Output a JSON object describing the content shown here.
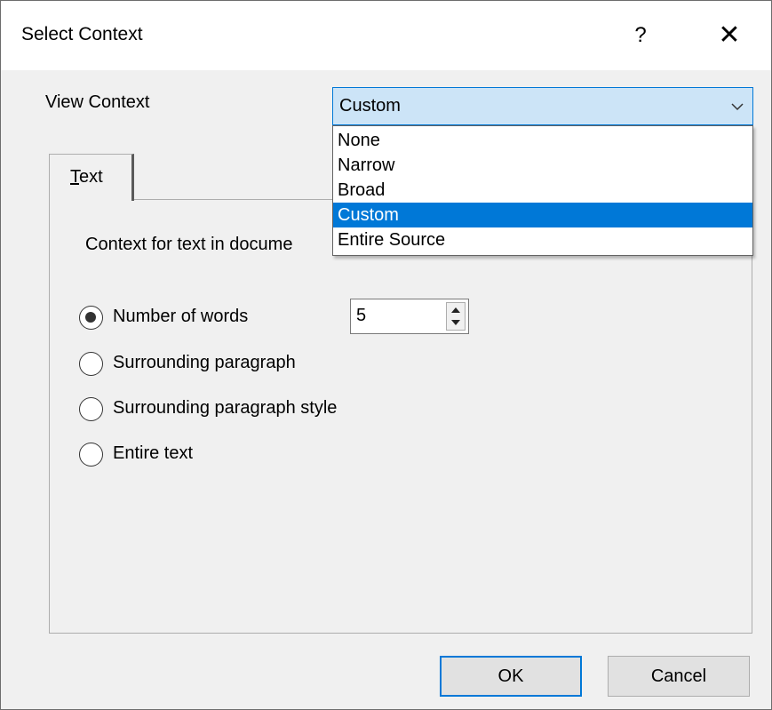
{
  "window": {
    "title": "Select Context",
    "help_label": "?",
    "close_label": "✕"
  },
  "view_context": {
    "label": "View Context",
    "selected": "Custom",
    "options": [
      "None",
      "Narrow",
      "Broad",
      "Custom",
      "Entire Source"
    ]
  },
  "tabs": [
    {
      "label_rest": "ext",
      "label_mnemonic": "T"
    }
  ],
  "text_tab": {
    "context_label": "Context for text in docume",
    "radios": [
      {
        "label": "Number of words",
        "checked": true
      },
      {
        "label": "Surrounding paragraph",
        "checked": false
      },
      {
        "label": "Surrounding paragraph style",
        "checked": false
      },
      {
        "label": "Entire text",
        "checked": false
      }
    ],
    "word_count": "5"
  },
  "buttons": {
    "ok": "OK",
    "cancel": "Cancel"
  },
  "colors": {
    "accent": "#0078d7",
    "combo_bg": "#cce4f7",
    "dialog_bg": "#f0f0f0"
  },
  "icons": {
    "combo_arrow": "chevron-down-icon",
    "spin_up": "triangle-up-icon",
    "spin_down": "triangle-down-icon"
  }
}
